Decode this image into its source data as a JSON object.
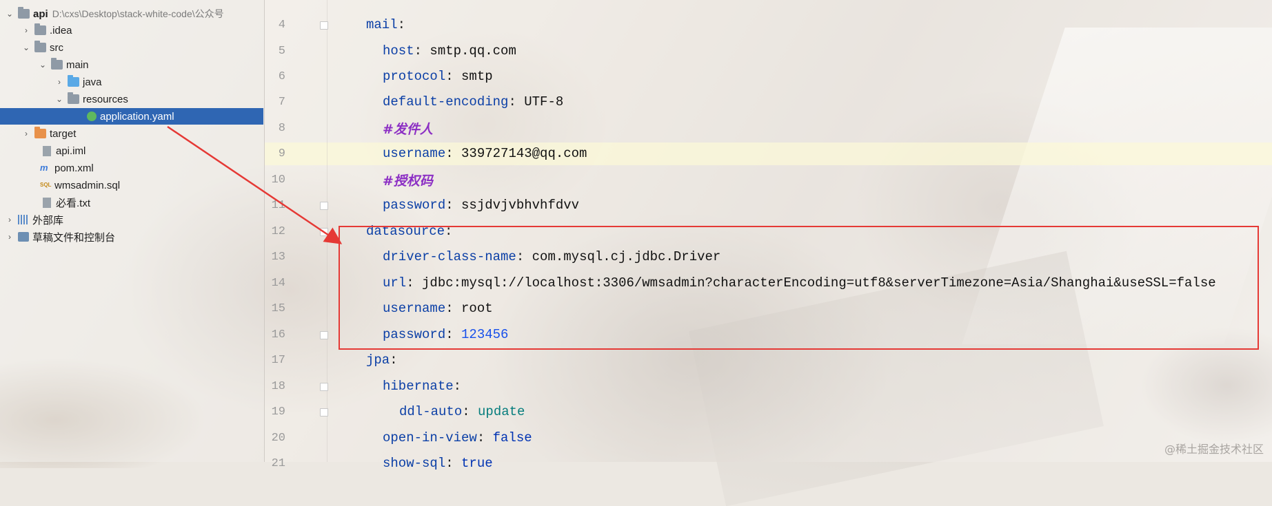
{
  "project_tree": {
    "root": {
      "name": "api",
      "path": "D:\\cxs\\Desktop\\stack-white-code\\公众号"
    },
    "items": [
      {
        "label": ".idea",
        "icon": "folder-icon"
      },
      {
        "label": "src",
        "icon": "folder-icon"
      },
      {
        "label": "main",
        "icon": "folder-icon"
      },
      {
        "label": "java",
        "icon": "source-folder-icon"
      },
      {
        "label": "resources",
        "icon": "resources-folder-icon"
      },
      {
        "label": "application.yaml",
        "icon": "yaml-file-icon"
      },
      {
        "label": "target",
        "icon": "excluded-folder-icon"
      },
      {
        "label": "api.iml",
        "icon": "iml-file-icon"
      },
      {
        "label": "pom.xml",
        "icon": "maven-icon"
      },
      {
        "label": "wmsadmin.sql",
        "icon": "sql-file-icon"
      },
      {
        "label": "必看.txt",
        "icon": "text-file-icon"
      },
      {
        "label": "外部库",
        "icon": "library-icon"
      },
      {
        "label": "草稿文件和控制台",
        "icon": "scratch-icon"
      }
    ]
  },
  "editor": {
    "lines": [
      {
        "num": "4",
        "key": "mail",
        "value": ""
      },
      {
        "num": "5",
        "key": "host",
        "value": "smtp.qq.com"
      },
      {
        "num": "6",
        "key": "protocol",
        "value": "smtp"
      },
      {
        "num": "7",
        "key": "default-encoding",
        "value": "UTF-8"
      },
      {
        "num": "8",
        "comment": "#发件人"
      },
      {
        "num": "9",
        "key": "username",
        "value": "339727143@qq.com"
      },
      {
        "num": "10",
        "comment": "#授权码"
      },
      {
        "num": "11",
        "key": "password",
        "value": "ssjdvjvbhvhfdvv"
      },
      {
        "num": "12",
        "key": "datasource",
        "value": ""
      },
      {
        "num": "13",
        "key": "driver-class-name",
        "value": "com.mysql.cj.jdbc.Driver"
      },
      {
        "num": "14",
        "key": "url",
        "value": "jdbc:mysql://localhost:3306/wmsadmin?characterEncoding=utf8&serverTimezone=Asia/Shanghai&useSSL=false"
      },
      {
        "num": "15",
        "key": "username",
        "value": "root"
      },
      {
        "num": "16",
        "key": "password",
        "value": "123456"
      },
      {
        "num": "17",
        "key": "jpa",
        "value": ""
      },
      {
        "num": "18",
        "key": "hibernate",
        "value": ""
      },
      {
        "num": "19",
        "key": "ddl-auto",
        "value": "update"
      },
      {
        "num": "20",
        "key": "open-in-view",
        "value": "false"
      },
      {
        "num": "21",
        "key": "show-sql",
        "value": "true"
      }
    ]
  },
  "colors": {
    "selection": "#2f66b3",
    "annotation_red": "#e53935",
    "yaml_key": "#0b3fa6",
    "comment": "#8c2fc4"
  },
  "watermark": "@稀土掘金技术社区"
}
